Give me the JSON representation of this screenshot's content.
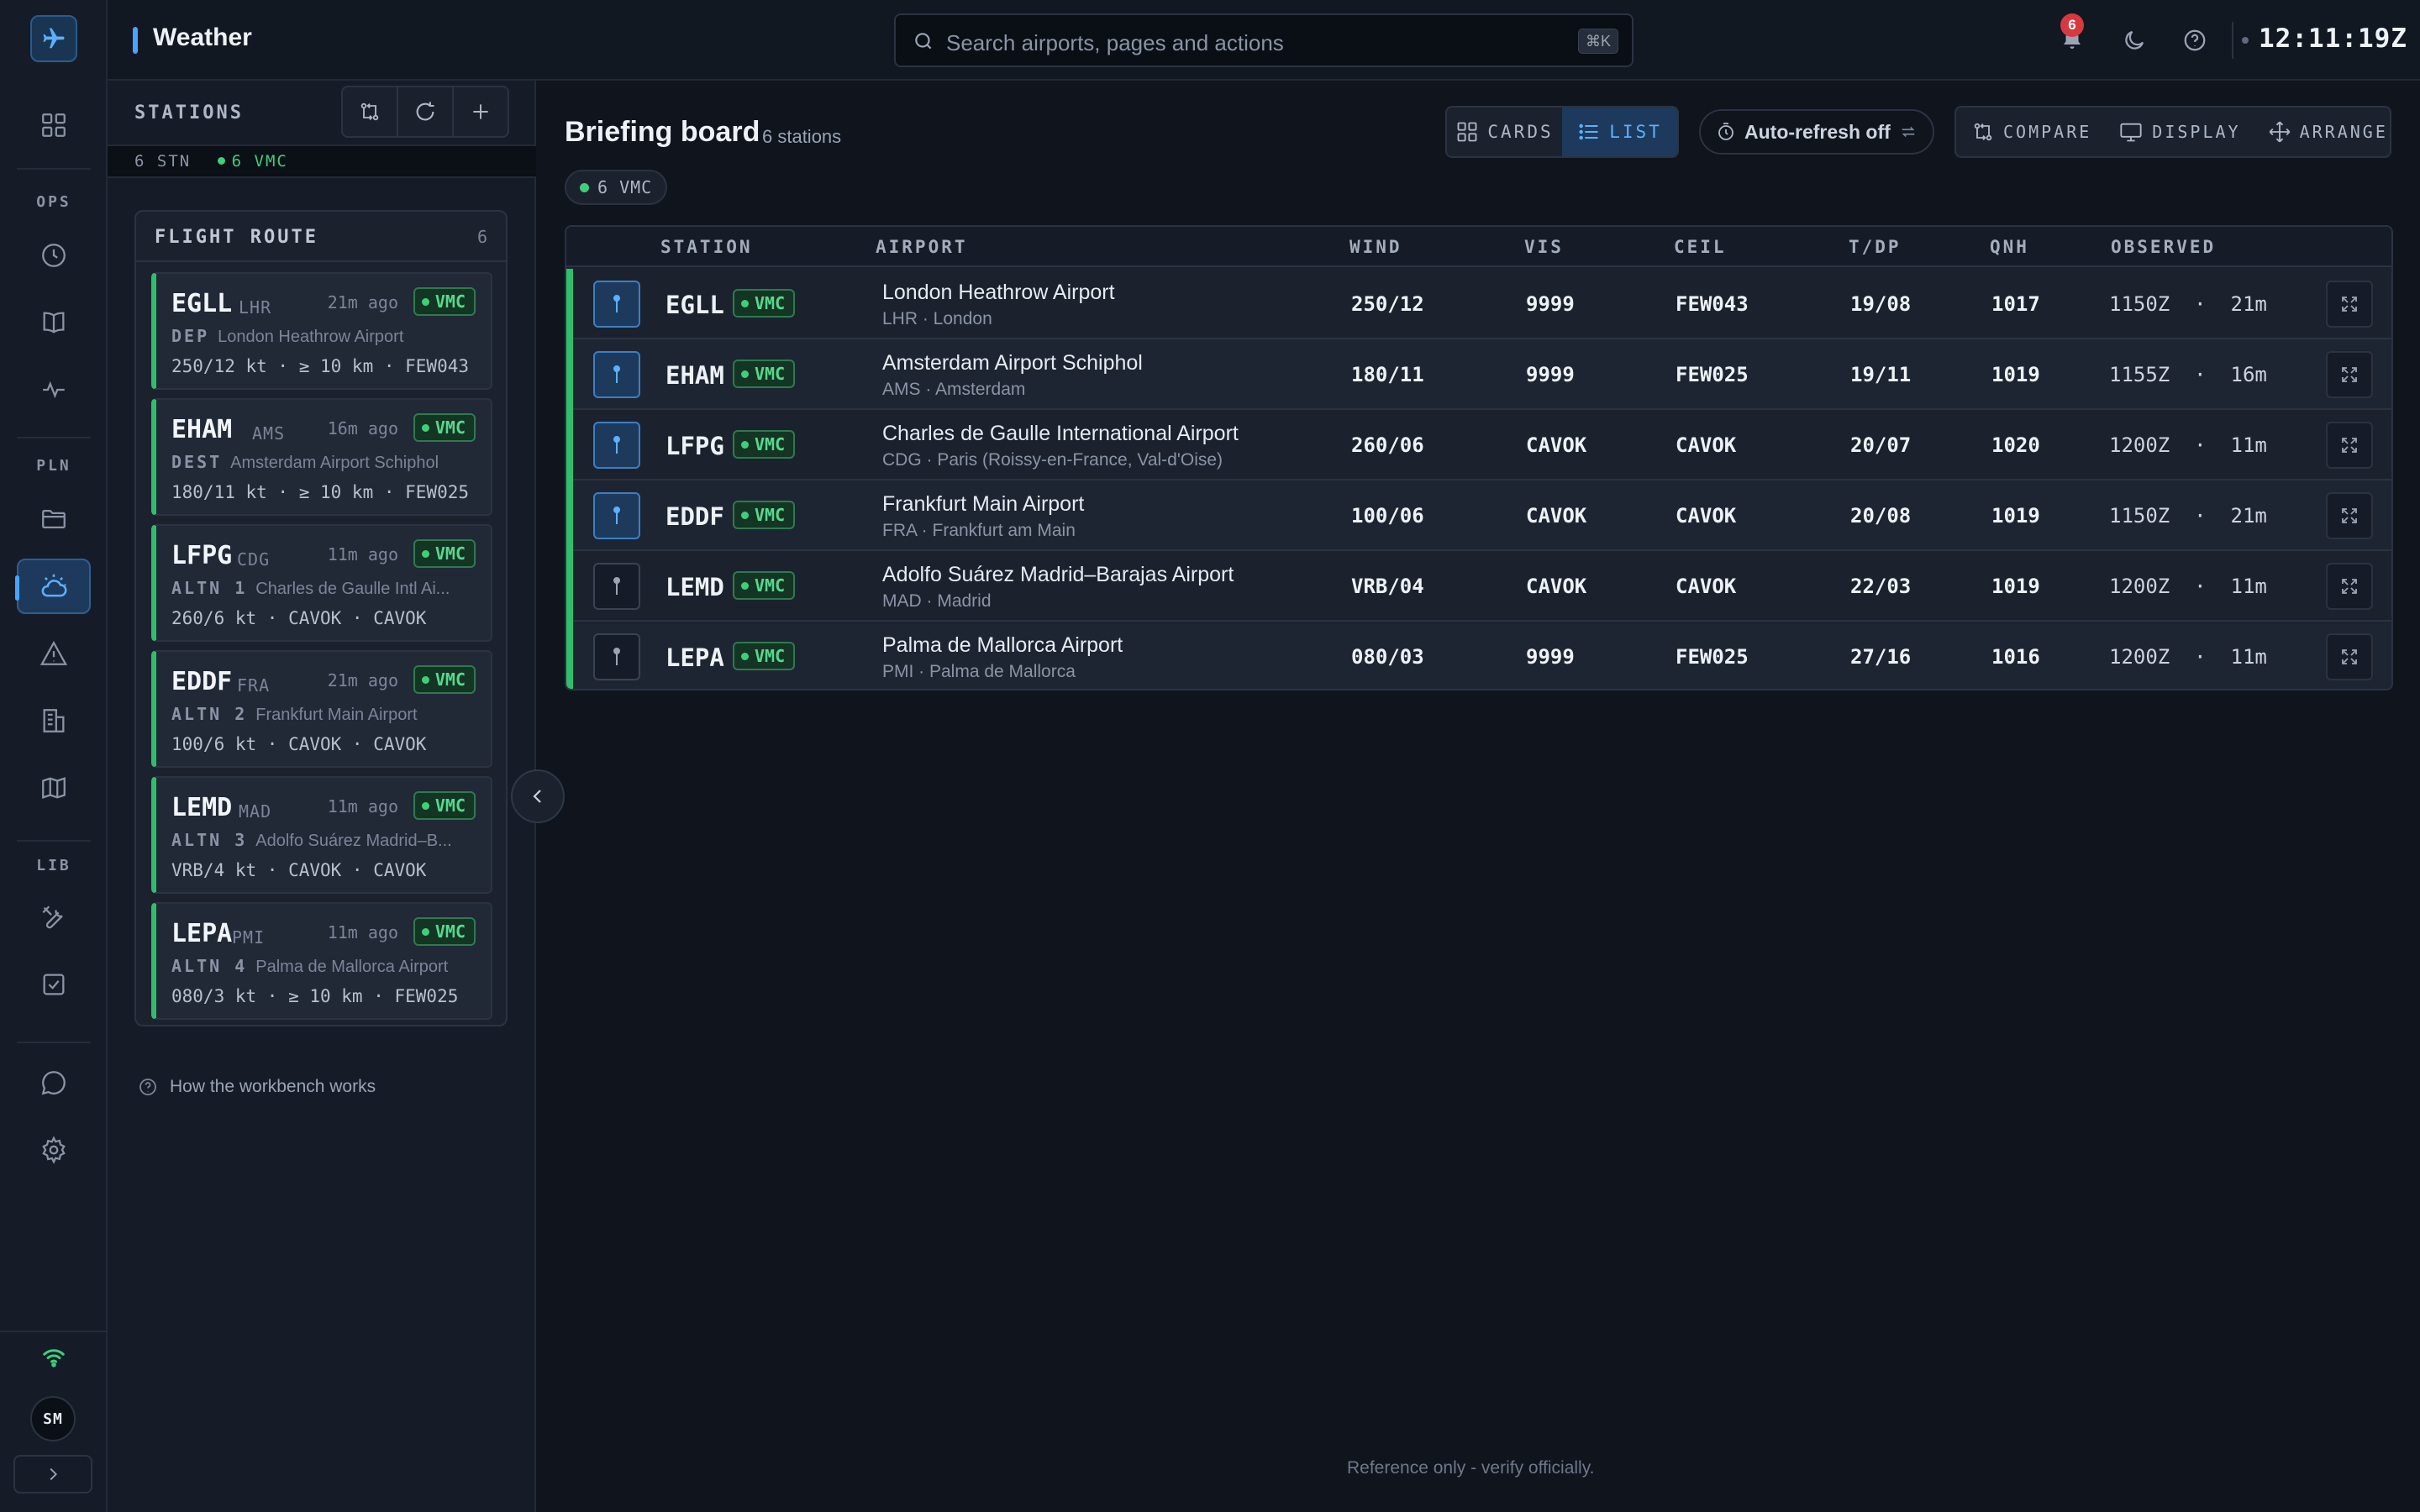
{
  "app": {
    "title": "Weather"
  },
  "header": {
    "search_placeholder": "Search airports, pages and actions",
    "search_shortcut": "⌘K",
    "notification_count": "6",
    "clock": "12:11:19Z"
  },
  "rail": {
    "sections": {
      "ops": "OPS",
      "pln": "PLN",
      "lib": "LIB"
    },
    "avatar": "SM",
    "active_item": "weather"
  },
  "stations_panel": {
    "title": "STATIONS",
    "count_stations": "6 STN",
    "count_vmc": "6 VMC",
    "route_title": "FLIGHT ROUTE",
    "route_count": "6",
    "help_link": "How the workbench works",
    "cards": [
      {
        "icao": "EGLL",
        "iata": "LHR",
        "ago": "21m ago",
        "category": "VMC",
        "role": "DEP",
        "name": "London Heathrow Airport",
        "wx": "250/12 kt · ≥ 10 km · FEW043"
      },
      {
        "icao": "EHAM",
        "iata": "AMS",
        "ago": "16m ago",
        "category": "VMC",
        "role": "DEST",
        "name": "Amsterdam Airport Schiphol",
        "wx": "180/11 kt · ≥ 10 km · FEW025"
      },
      {
        "icao": "LFPG",
        "iata": "CDG",
        "ago": "11m ago",
        "category": "VMC",
        "role": "ALTN 1",
        "name": "Charles de Gaulle Intl Ai...",
        "wx": "260/6 kt · CAVOK · CAVOK"
      },
      {
        "icao": "EDDF",
        "iata": "FRA",
        "ago": "21m ago",
        "category": "VMC",
        "role": "ALTN 2",
        "name": "Frankfurt Main Airport",
        "wx": "100/6 kt · CAVOK · CAVOK"
      },
      {
        "icao": "LEMD",
        "iata": "MAD",
        "ago": "11m ago",
        "category": "VMC",
        "role": "ALTN 3",
        "name": "Adolfo Suárez Madrid–B...",
        "wx": "VRB/4 kt · CAVOK · CAVOK"
      },
      {
        "icao": "LEPA",
        "iata": "PMI",
        "ago": "11m ago",
        "category": "VMC",
        "role": "ALTN 4",
        "name": "Palma de Mallorca Airport",
        "wx": "080/3 kt · ≥ 10 km · FEW025"
      }
    ]
  },
  "board": {
    "title": "Briefing board",
    "subtitle": "6 stations",
    "view_cards": "CARDS",
    "view_list": "LIST",
    "active_view": "list",
    "auto_refresh": "Auto-refresh off",
    "tools": {
      "compare": "COMPARE",
      "display": "DISPLAY",
      "arrange": "ARRANGE"
    },
    "filter_chip": "6 VMC",
    "columns": {
      "station": "STATION",
      "airport": "AIRPORT",
      "wind": "WIND",
      "vis": "VIS",
      "ceil": "CEIL",
      "tdp": "T/DP",
      "qnh": "QNH",
      "observed": "OBSERVED"
    },
    "rows": [
      {
        "icao": "EGLL",
        "category": "VMC",
        "pinned": true,
        "name": "London Heathrow Airport",
        "loc": "LHR · London",
        "wind": "250/12",
        "vis": "9999",
        "ceil": "FEW043",
        "tdp": "19/08",
        "qnh": "1017",
        "observed": "1150Z  ·  21m"
      },
      {
        "icao": "EHAM",
        "category": "VMC",
        "pinned": true,
        "name": "Amsterdam Airport Schiphol",
        "loc": "AMS · Amsterdam",
        "wind": "180/11",
        "vis": "9999",
        "ceil": "FEW025",
        "tdp": "19/11",
        "qnh": "1019",
        "observed": "1155Z  ·  16m"
      },
      {
        "icao": "LFPG",
        "category": "VMC",
        "pinned": true,
        "name": "Charles de Gaulle International Airport",
        "loc": "CDG · Paris (Roissy-en-France, Val-d'Oise)",
        "wind": "260/06",
        "vis": "CAVOK",
        "ceil": "CAVOK",
        "tdp": "20/07",
        "qnh": "1020",
        "observed": "1200Z  ·  11m"
      },
      {
        "icao": "EDDF",
        "category": "VMC",
        "pinned": true,
        "name": "Frankfurt Main Airport",
        "loc": "FRA · Frankfurt am Main",
        "wind": "100/06",
        "vis": "CAVOK",
        "ceil": "CAVOK",
        "tdp": "20/08",
        "qnh": "1019",
        "observed": "1150Z  ·  21m"
      },
      {
        "icao": "LEMD",
        "category": "VMC",
        "pinned": false,
        "name": "Adolfo Suárez Madrid–Barajas Airport",
        "loc": "MAD · Madrid",
        "wind": "VRB/04",
        "vis": "CAVOK",
        "ceil": "CAVOK",
        "tdp": "22/03",
        "qnh": "1019",
        "observed": "1200Z  ·  11m"
      },
      {
        "icao": "LEPA",
        "category": "VMC",
        "pinned": false,
        "name": "Palma de Mallorca Airport",
        "loc": "PMI · Palma de Mallorca",
        "wind": "080/03",
        "vis": "9999",
        "ceil": "FEW025",
        "tdp": "27/16",
        "qnh": "1016",
        "observed": "1200Z  ·  11m"
      }
    ]
  },
  "footer": "Reference only - verify officially.",
  "colors": {
    "accent": "#4aa3ff",
    "vmc": "#3ecf7a",
    "badge_red": "#d8383f"
  }
}
